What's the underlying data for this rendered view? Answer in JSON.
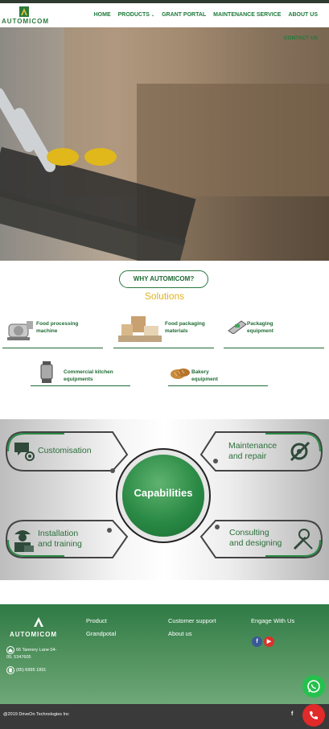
{
  "header": {
    "logo_text": "AUTOMICOM",
    "nav": [
      "HOME",
      "PRODUCTS",
      "GRANT PORTAL",
      "MAINTENANCE SERVICE",
      "ABOUT US"
    ],
    "contact": "CONTACT US"
  },
  "intro": {
    "why_button": "WHY AUTOMICOM?",
    "solutions_title": "Solutions"
  },
  "products": [
    {
      "line1": "Food processing",
      "line2": "machine"
    },
    {
      "line1": "Food packaging",
      "line2": "materials"
    },
    {
      "line1": "Packaging",
      "line2": "equipment"
    },
    {
      "line1": "Commercial kitchen",
      "line2": "equipments"
    },
    {
      "line1": "Bakery",
      "line2": "equipment"
    }
  ],
  "capabilities": {
    "center": "Capabilities",
    "items": [
      {
        "line1": "Customisation",
        "line2": ""
      },
      {
        "line1": "Maintenance",
        "line2": "and repair"
      },
      {
        "line1": "Installation",
        "line2": "and training"
      },
      {
        "line1": "Consulting",
        "line2": "and designing"
      }
    ]
  },
  "footer": {
    "logo_text": "AUTOMICOM",
    "address_line1": "66 Tannery Lane 04-",
    "address_line2": "09, 5347605",
    "phone": "(65) 6995 1891",
    "col1": [
      "Product",
      "Grandpotal"
    ],
    "col2": [
      "Customer support",
      "About us"
    ],
    "engage_title": "Engage With Us",
    "copyright": "@2019 DriveOn Technologies Inc"
  },
  "colors": {
    "brand_green": "#1e7a3a",
    "accent_yellow": "#e2b21f",
    "whatsapp": "#25c14d",
    "call": "#e12a2a"
  }
}
